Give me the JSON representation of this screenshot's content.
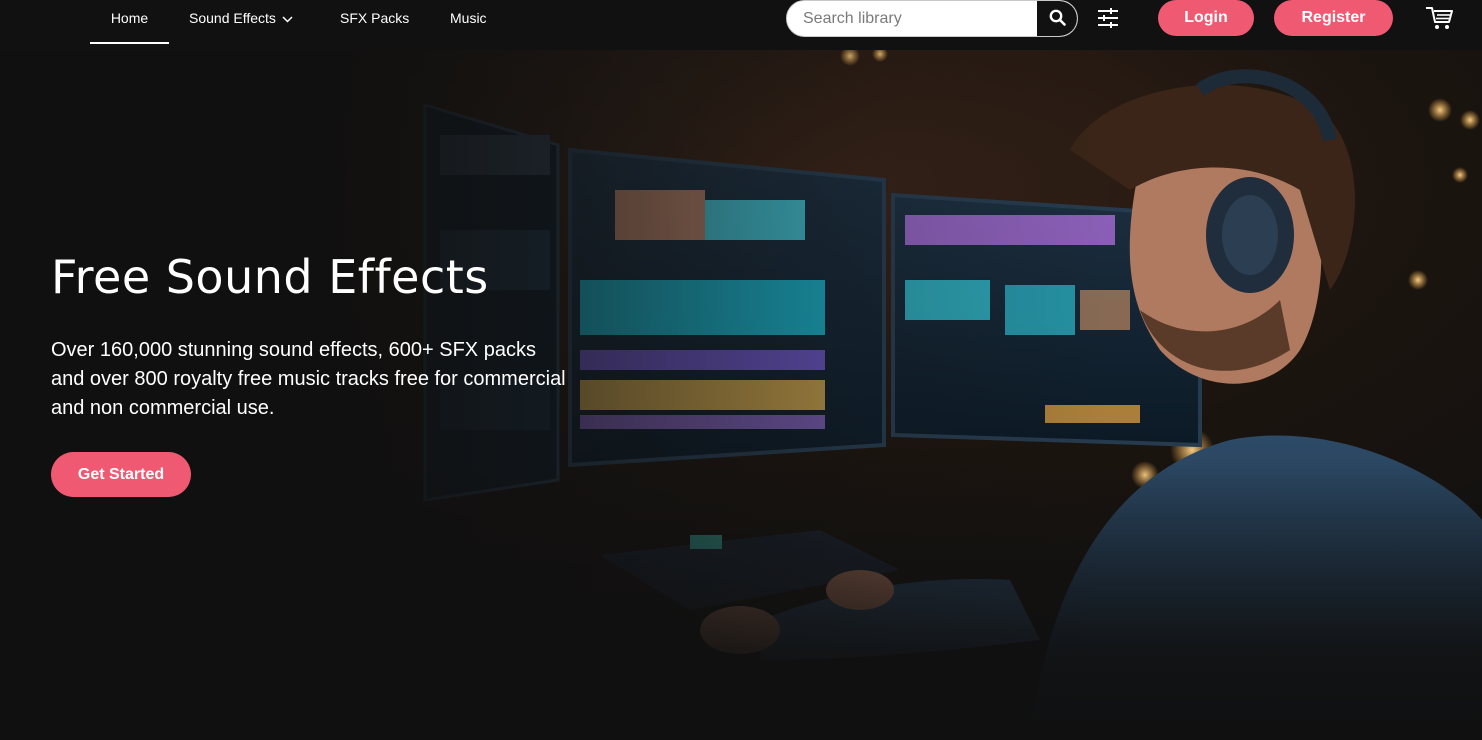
{
  "nav": {
    "items": [
      {
        "label": "Home",
        "active": true
      },
      {
        "label": "Sound Effects",
        "has_dropdown": true
      },
      {
        "label": "SFX Packs"
      },
      {
        "label": "Music"
      }
    ]
  },
  "search": {
    "placeholder": "Search library",
    "button_icon": "search-icon"
  },
  "toolbar": {
    "filter_icon": "sliders-icon",
    "login_label": "Login",
    "register_label": "Register",
    "cart_icon": "cart-icon"
  },
  "hero": {
    "title": "Free Sound Effects",
    "description": "Over 160,000 stunning sound effects, 600+ SFX packs and over 800 royalty free music tracks free for commercial and non commercial use.",
    "cta_label": "Get Started"
  },
  "colors": {
    "accent": "#ef5a72",
    "background": "#101010",
    "topbar": "#111111",
    "text": "#ffffff"
  }
}
